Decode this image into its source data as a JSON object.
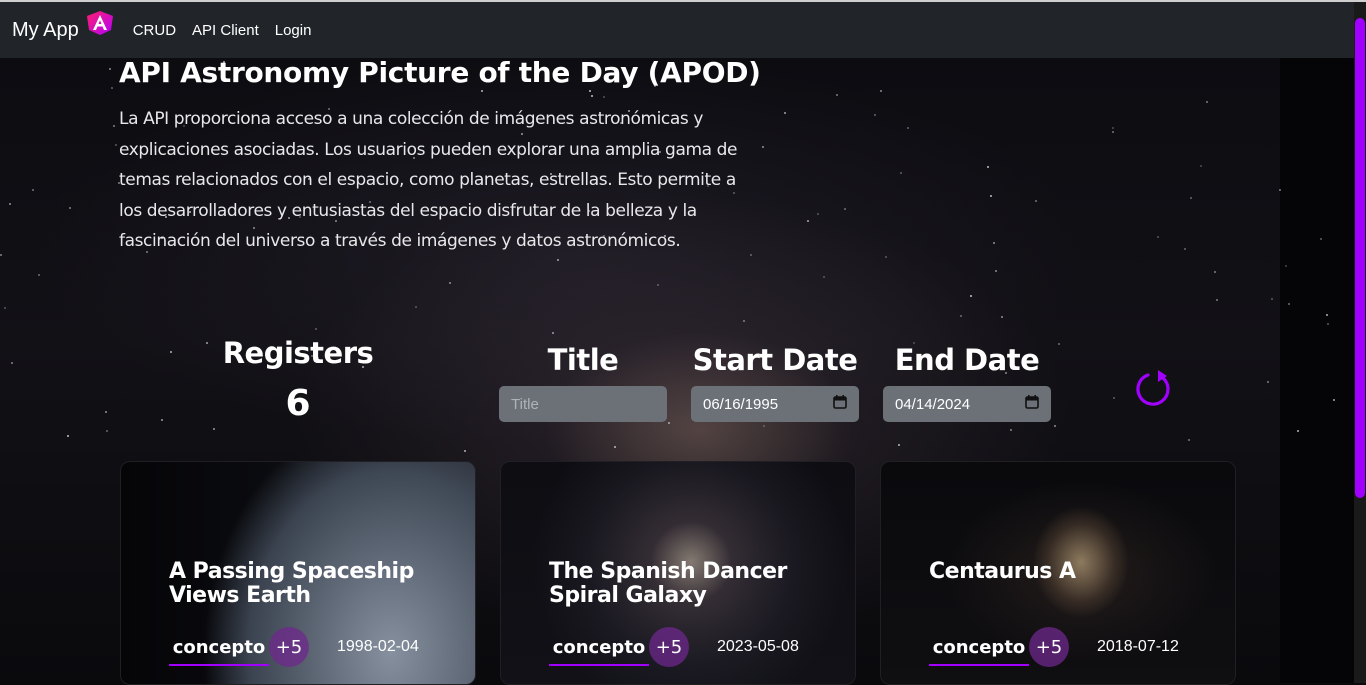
{
  "navbar": {
    "brand": "My App",
    "links": [
      "CRUD",
      "API Client",
      "Login"
    ]
  },
  "header": {
    "title": "API Astronomy Picture of the Day (APOD)",
    "description": "La API proporciona acceso a una colección de imágenes astronómicas y explicaciones asociadas. Los usuarios pueden explorar una amplia gama de temas relacionados con el espacio, como planetas, estrellas. Esto permite a los desarrolladores y entusiastas del espacio disfrutar de la belleza y la fascinación del universo a través de imágenes y datos astronómicos."
  },
  "stats": {
    "registers_label": "Registers",
    "registers_count": "6"
  },
  "filters": {
    "title_label": "Title",
    "title_placeholder": "Title",
    "title_value": "",
    "start_label": "Start Date",
    "start_value": "06/16/1995",
    "end_label": "End Date",
    "end_value": "04/14/2024",
    "refresh_icon": "refresh-icon"
  },
  "cards": [
    {
      "title": "A Passing Spaceship Views Earth",
      "tag": "concepto",
      "more": "+5",
      "date": "1998-02-04"
    },
    {
      "title": "The Spanish Dancer Spiral Galaxy",
      "tag": "concepto",
      "more": "+5",
      "date": "2023-05-08"
    },
    {
      "title": "Centaurus A",
      "tag": "concepto",
      "more": "+5",
      "date": "2018-07-12"
    }
  ],
  "colors": {
    "accent": "#a100ff",
    "navbar": "#212529",
    "input": "#6c7178"
  }
}
